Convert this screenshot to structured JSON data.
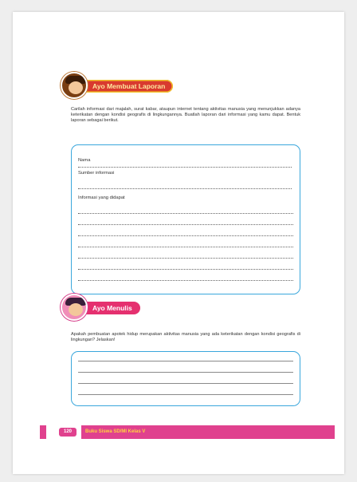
{
  "section1": {
    "title": "Ayo Membuat Laporan",
    "instruction": "Carilah informasi dari majalah, surat kabar, ataupun internet tentang aktivitas manusia yang menunjukkan adanya keterikatan dengan kondisi geografis di lingkungannya. Buatlah laporan dari informasi yang kamu dapat. Bentuk laporan sebagai berikut."
  },
  "form": {
    "name_label": "Nama",
    "source_label": "Sumber informasi",
    "info_label": "Informasi yang didapat"
  },
  "section2": {
    "title": "Ayo Menulis",
    "question": "Apakah pembuatan apotek hidup merupakan aktivitas manusia yang ada keterikatan dengan kondisi geografis di lingkungan? Jelaskan!"
  },
  "footer": {
    "page_number": "120",
    "book_title": "Buku Siswa SD/MI Kelas V"
  },
  "colors": {
    "box_border": "#3aa7dc",
    "footer": "#e0418e",
    "section1_pill": "#d93a2f",
    "section2_pill": "#e5306f",
    "footer_text": "#ffd23f"
  }
}
